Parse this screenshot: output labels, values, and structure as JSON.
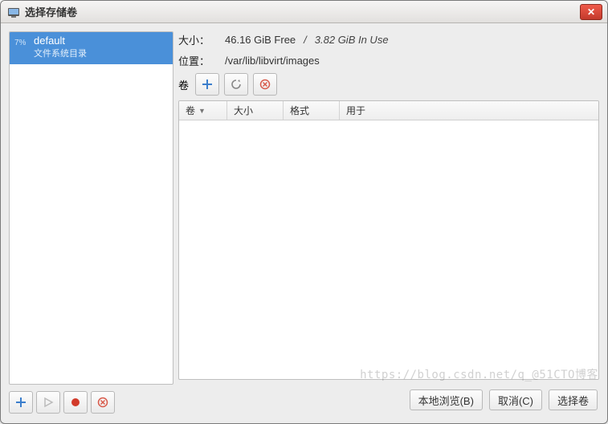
{
  "window": {
    "title": "选择存储卷"
  },
  "sidebar": {
    "pools": [
      {
        "usage_pct": "7%",
        "name": "default",
        "subtitle": "文件系统目录"
      }
    ]
  },
  "info": {
    "size_label": "大小：",
    "size_free": "46.16 GiB Free",
    "size_sep": "/",
    "size_used": "3.82 GiB In Use",
    "location_label": "位置：",
    "location_value": "/var/lib/libvirt/images"
  },
  "vol_toolbar": {
    "label": "卷"
  },
  "vol_table": {
    "headers": {
      "name": "卷",
      "size": "大小",
      "format": "格式",
      "used_by": "用于"
    },
    "rows": []
  },
  "footer": {
    "browse": "本地浏览(B)",
    "cancel": "取消(C)",
    "choose": "选择卷"
  },
  "watermark": "https://blog.csdn.net/q_@51CTO博客"
}
